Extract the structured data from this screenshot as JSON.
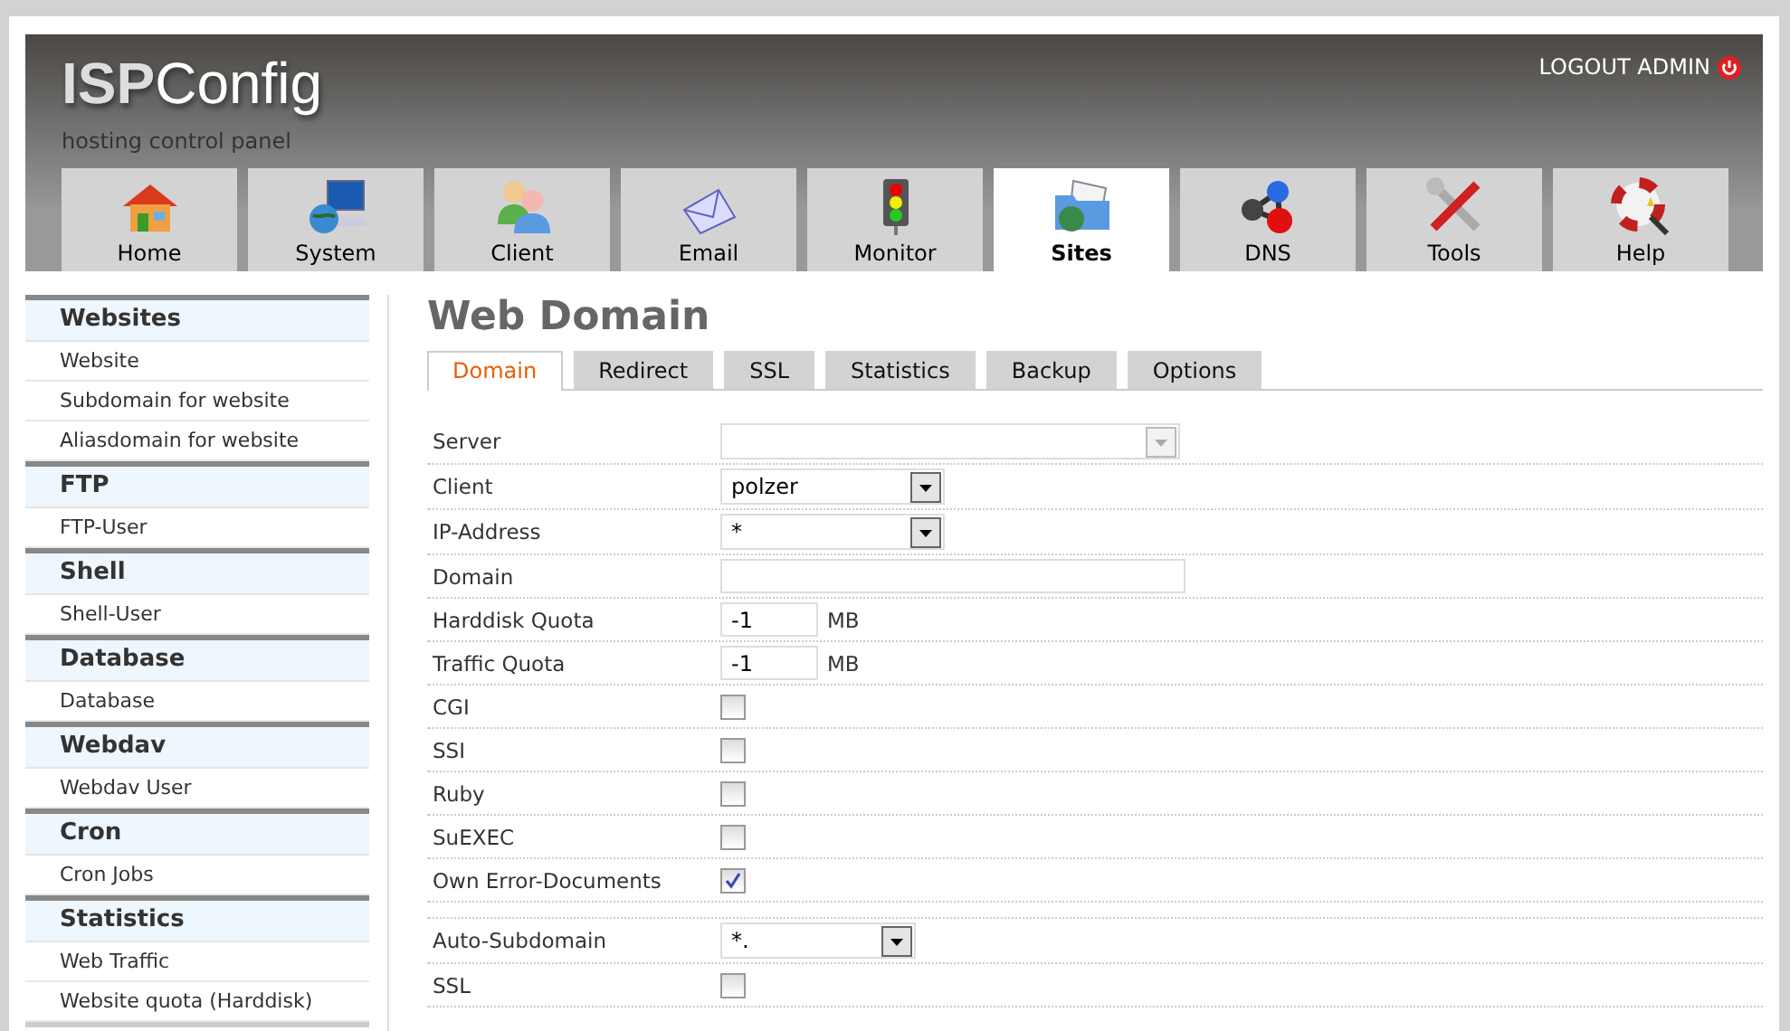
{
  "header": {
    "logo": "**ISP**Config",
    "subtitle": "hosting control panel",
    "logout": "LOGOUT ADMIN"
  },
  "modules": [
    {
      "label": "Home",
      "selected": false
    },
    {
      "label": "System",
      "selected": false
    },
    {
      "label": "Client",
      "selected": false
    },
    {
      "label": "Email",
      "selected": false
    },
    {
      "label": "Monitor",
      "selected": false
    },
    {
      "label": "Sites",
      "selected": true
    },
    {
      "label": "DNS",
      "selected": false
    },
    {
      "label": "Tools",
      "selected": false
    },
    {
      "label": "Help",
      "selected": false
    }
  ],
  "sidebar": [
    {
      "title": "Websites",
      "items": [
        "Website",
        "Subdomain for website",
        "Aliasdomain for website"
      ]
    },
    {
      "title": "FTP",
      "items": [
        "FTP-User"
      ]
    },
    {
      "title": "Shell",
      "items": [
        "Shell-User"
      ]
    },
    {
      "title": "Database",
      "items": [
        "Database"
      ]
    },
    {
      "title": "Webdav",
      "items": [
        "Webdav User"
      ]
    },
    {
      "title": "Cron",
      "items": [
        "Cron Jobs"
      ]
    },
    {
      "title": "Statistics",
      "items": [
        "Web Traffic",
        "Website quota (Harddisk)"
      ]
    }
  ],
  "page": {
    "title": "Web Domain"
  },
  "tabs": [
    {
      "label": "Domain",
      "selected": true
    },
    {
      "label": "Redirect",
      "selected": false
    },
    {
      "label": "SSL",
      "selected": false
    },
    {
      "label": "Statistics",
      "selected": false
    },
    {
      "label": "Backup",
      "selected": false
    },
    {
      "label": "Options",
      "selected": false
    }
  ],
  "fields": [
    {
      "kind": "select",
      "label": "Server",
      "disabled": true
    },
    {
      "kind": "select",
      "label": "Client",
      "value": "polzer",
      "disabled": false
    },
    {
      "kind": "select",
      "label": "IP-Address",
      "value": "*",
      "disabled": false
    },
    {
      "kind": "text",
      "label": "Domain"
    },
    {
      "kind": "quota",
      "label": "Harddisk Quota",
      "value": "-1",
      "unit": "MB"
    },
    {
      "kind": "quota",
      "label": "Traffic Quota",
      "value": "-1",
      "unit": "MB"
    },
    {
      "kind": "checkbox",
      "label": "CGI",
      "checked": false
    },
    {
      "kind": "checkbox",
      "label": "SSI",
      "checked": false
    },
    {
      "kind": "checkbox",
      "label": "Ruby",
      "checked": false
    },
    {
      "kind": "checkbox",
      "label": "SuEXEC",
      "checked": false
    },
    {
      "kind": "checkbox",
      "label": "Own Error-Documents",
      "checked": true
    },
    {
      "kind": "spacer"
    },
    {
      "kind": "select",
      "label": "Auto-Subdomain",
      "value": "*.",
      "disabled": false
    },
    {
      "kind": "checkbox",
      "label": "SSL",
      "checked": false
    }
  ]
}
